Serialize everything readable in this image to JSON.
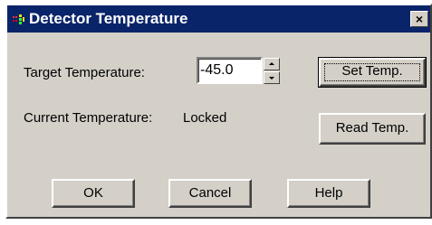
{
  "window": {
    "title": "Detector Temperature",
    "close_label": "×"
  },
  "form": {
    "target_label": "Target Temperature:",
    "target_value": "-45.0",
    "current_label": "Current Temperature:",
    "current_value": "Locked"
  },
  "buttons": {
    "set_temp": "Set Temp.",
    "read_temp": "Read Temp.",
    "ok": "OK",
    "cancel": "Cancel",
    "help": "Help"
  },
  "icons": {
    "app": "app-icon",
    "spin_up": "spin-up-arrow-icon",
    "spin_down": "spin-down-arrow-icon"
  },
  "colors": {
    "titlebar": "#0a246a",
    "dialog_face": "#d4d0c8"
  }
}
